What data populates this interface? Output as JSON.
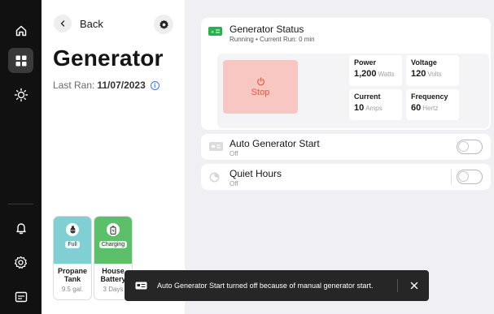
{
  "sidebar": {
    "top_icons": [
      "home-icon",
      "grid-icon",
      "sun-icon"
    ],
    "bottom_icons": [
      "bell-icon",
      "settings-icon",
      "monitor-icon"
    ],
    "active": "grid-icon"
  },
  "panel": {
    "back_label": "Back",
    "title": "Generator",
    "last_ran_label": "Last Ran:",
    "last_ran_value": "11/07/2023",
    "tiles": [
      {
        "name": "Propane Tank",
        "badge": "Full",
        "sub": "9.5 gal.",
        "color": "#7fcfd3",
        "icon": "propane-tank-icon"
      },
      {
        "name": "House Battery",
        "badge": "Charging",
        "sub": "3 Days",
        "color": "#5cc06a",
        "icon": "battery-icon"
      }
    ]
  },
  "status": {
    "title": "Generator Status",
    "subtitle": "Running • Current Run: 0 min",
    "stop_label": "Stop",
    "stats": [
      {
        "label": "Power",
        "value": "1,200",
        "unit": "Watts"
      },
      {
        "label": "Voltage",
        "value": "120",
        "unit": "Volts"
      },
      {
        "label": "Current",
        "value": "10",
        "unit": "Amps"
      },
      {
        "label": "Frequency",
        "value": "60",
        "unit": "Hertz"
      }
    ]
  },
  "auto_start": {
    "title": "Auto Generator Start",
    "state": "Off"
  },
  "quiet_hours": {
    "title": "Quiet Hours",
    "state": "Off"
  },
  "toast": {
    "message": "Auto Generator Start turned off because of manual generator start."
  },
  "colors": {
    "accent_green": "#28b14c",
    "stop_bg": "#f8c7c1",
    "stop_text": "#e05a3d",
    "info_blue": "#3a7be0"
  }
}
